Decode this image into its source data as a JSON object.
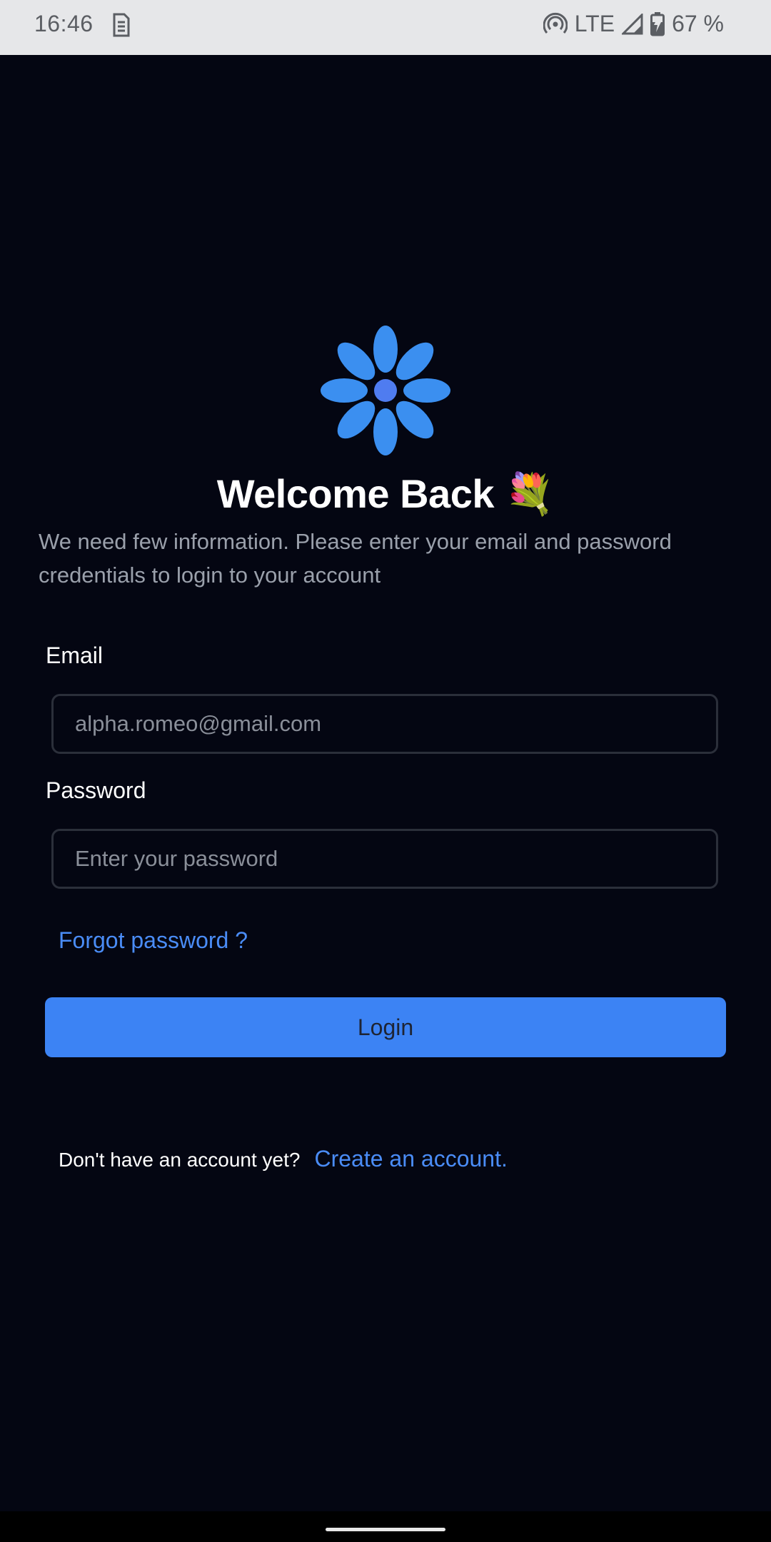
{
  "status_bar": {
    "time": "16:46",
    "network": "LTE",
    "battery": "67 %",
    "icons": [
      "sim-card-icon",
      "hotspot-icon",
      "signal-icon",
      "battery-charging-icon"
    ]
  },
  "login": {
    "title": "Welcome Back 💐",
    "subtitle": "We need few information. Please enter your email and password credentials to login to your account",
    "email_label": "Email",
    "email_value": "alpha.romeo@gmail.com",
    "password_label": "Password",
    "password_placeholder": "Enter your password",
    "forgot_password": "Forgot password ?",
    "login_button": "Login",
    "signup_prompt": "Don't have an account yet?",
    "signup_link": "Create an account."
  },
  "colors": {
    "background": "#040612",
    "accent": "#3c83f4",
    "link": "#4a8cf6",
    "logo": "#3b8ff0"
  }
}
